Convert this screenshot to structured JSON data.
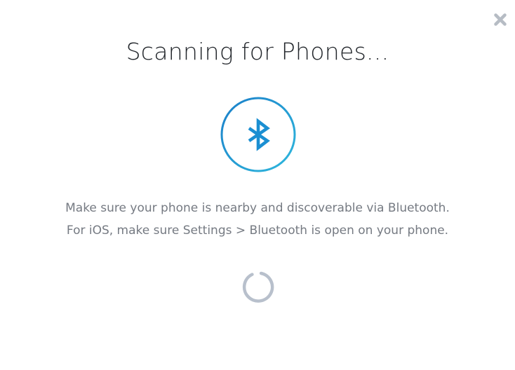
{
  "dialog": {
    "title": "Scanning for Phones...",
    "close_icon": "close-x-icon",
    "status_icon": "bluetooth-icon",
    "messages": [
      "Make sure your phone is nearby and discoverable via Bluetooth.",
      "For iOS, make sure Settings > Bluetooth is open on your phone."
    ],
    "loading_icon": "spinner-icon"
  },
  "colors": {
    "accent_blue": "#1b8fd2",
    "ring_light": "#2eb3dc",
    "title_text": "#22262b",
    "body_text": "#757a82",
    "close_icon": "#b6bcc4",
    "spinner": "#b8c0cc"
  }
}
